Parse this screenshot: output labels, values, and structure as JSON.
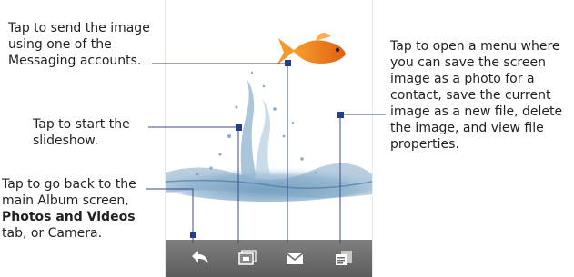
{
  "callouts": {
    "send": "Tap to send the image using one of the Messaging accounts.",
    "slideshow": "Tap to start the slideshow.",
    "back_prefix": "Tap to go back to the main Album screen, ",
    "back_bold": "Photos and Videos",
    "back_suffix": " tab, or Camera.",
    "menu": "Tap to open a menu where you can save the screen image as a photo for a contact, save the current image as a new file, delete the image, and view file properties."
  },
  "toolbar": {
    "buttons": [
      {
        "name": "back",
        "icon": "back-arrow-icon"
      },
      {
        "name": "slideshow",
        "icon": "slideshow-icon"
      },
      {
        "name": "send",
        "icon": "envelope-icon"
      },
      {
        "name": "menu",
        "icon": "menu-icon"
      }
    ]
  },
  "colors": {
    "leader_line": "#3b4a8a",
    "anchor": "#1f3f8f",
    "toolbar": "#6a6a6a",
    "fish": "#f08a1a"
  }
}
